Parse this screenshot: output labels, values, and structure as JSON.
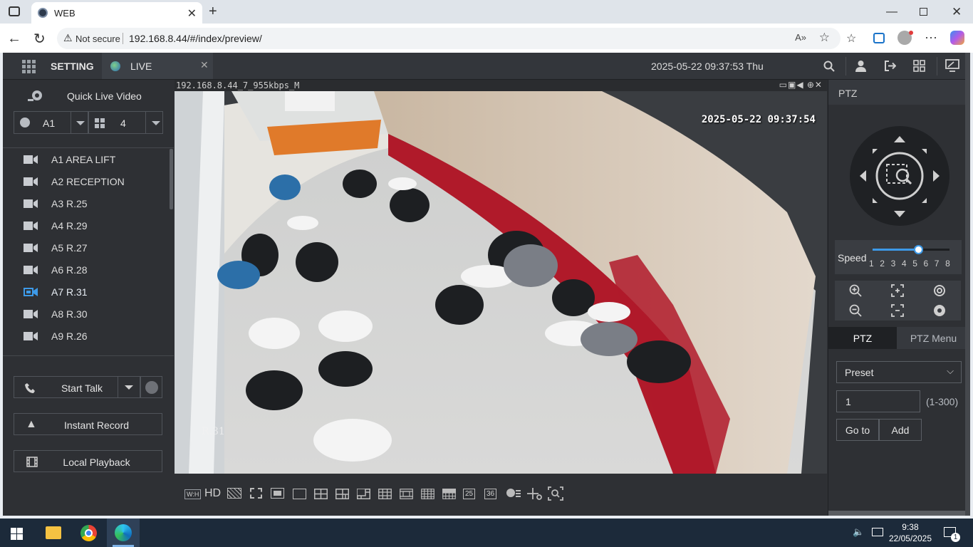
{
  "browser": {
    "tab_title": "WEB",
    "not_secure": "Not secure",
    "url": "192.168.8.44/#/index/preview/"
  },
  "nav": {
    "setting": "SETTING",
    "live": "LIVE",
    "datetime": "2025-05-22 09:37:53 Thu"
  },
  "left": {
    "quick_live": "Quick Live Video",
    "area_select": "A1",
    "split_select": "4",
    "devices": [
      {
        "label": "A1 AREA LIFT",
        "active": false
      },
      {
        "label": "A2 RECEPTION",
        "active": false
      },
      {
        "label": "A3 R.25",
        "active": false
      },
      {
        "label": "A4 R.29",
        "active": false
      },
      {
        "label": "A5 R.27",
        "active": false
      },
      {
        "label": "A6 R.28",
        "active": false
      },
      {
        "label": "A7 R.31",
        "active": true
      },
      {
        "label": "A8 R.30",
        "active": false
      },
      {
        "label": "A9 R.26",
        "active": false
      }
    ],
    "start_talk": "Start Talk",
    "instant_record": "Instant Record",
    "local_playback": "Local Playback"
  },
  "video": {
    "stream_label": "192.168.8.44_7_955kbps_M",
    "overlay_timestamp": "2025-05-22 09:37:54",
    "room_mark": "R.31"
  },
  "bottom": {
    "hd": "HD",
    "n25": "25",
    "n36": "36",
    "wh": "W:H"
  },
  "ptz": {
    "header": "PTZ",
    "speed_label": "Speed",
    "speed_ticks": [
      "1",
      "2",
      "3",
      "4",
      "5",
      "6",
      "7",
      "8"
    ],
    "speed_value": 5,
    "tab_ptz": "PTZ",
    "tab_menu": "PTZ Menu",
    "preset_select": "Preset",
    "preset_value": "1",
    "preset_range": "(1-300)",
    "goto": "Go to",
    "add": "Add"
  },
  "taskbar": {
    "time": "9:38",
    "date": "22/05/2025",
    "notif_count": "1"
  },
  "colors": {
    "accent": "#3d9ae8",
    "app_bg": "#2e3034",
    "wall_red": "#b01a2a"
  }
}
